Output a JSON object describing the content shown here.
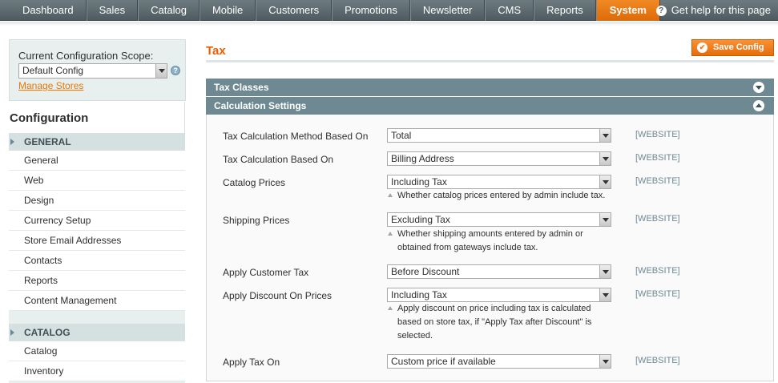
{
  "nav": {
    "items": [
      "Dashboard",
      "Sales",
      "Catalog",
      "Mobile",
      "Customers",
      "Promotions",
      "Newsletter",
      "CMS",
      "Reports",
      "System"
    ],
    "active": "System",
    "help": "Get help for this page"
  },
  "scope": {
    "label": "Current Configuration Scope:",
    "selected": "Default Config",
    "manage_link": "Manage Stores"
  },
  "sidebar": {
    "title": "Configuration",
    "general_header": "GENERAL",
    "general_items": [
      "General",
      "Web",
      "Design",
      "Currency Setup",
      "Store Email Addresses",
      "Contacts",
      "Reports",
      "Content Management"
    ],
    "catalog_header": "CATALOG",
    "catalog_items": [
      "Catalog",
      "Inventory"
    ]
  },
  "main": {
    "title": "Tax",
    "save_label": "Save Config",
    "sections": {
      "tax_classes": "Tax Classes",
      "calculation_settings": "Calculation Settings"
    },
    "rows": [
      {
        "label": "Tax Calculation Method Based On",
        "value": "Total",
        "scope": "[WEBSITE]"
      },
      {
        "label": "Tax Calculation Based On",
        "value": "Billing Address",
        "scope": "[WEBSITE]"
      },
      {
        "label": "Catalog Prices",
        "value": "Including Tax",
        "scope": "[WEBSITE]",
        "note": [
          "Whether catalog prices entered by admin include tax."
        ]
      },
      {
        "label": "Shipping Prices",
        "value": "Excluding Tax",
        "scope": "[WEBSITE]",
        "note": [
          "Whether shipping amounts entered by admin or",
          "obtained from gateways include tax."
        ]
      },
      {
        "label": "Apply Customer Tax",
        "value": "Before Discount",
        "scope": "[WEBSITE]"
      },
      {
        "label": "Apply Discount On Prices",
        "value": "Including Tax",
        "scope": "[WEBSITE]",
        "note": [
          "Apply discount on price including tax is calculated",
          "based on store tax, if \"Apply Tax after Discount\" is",
          "selected."
        ]
      },
      {
        "label": "Apply Tax On",
        "value": "Custom price if available",
        "scope": "[WEBSITE]"
      }
    ]
  }
}
